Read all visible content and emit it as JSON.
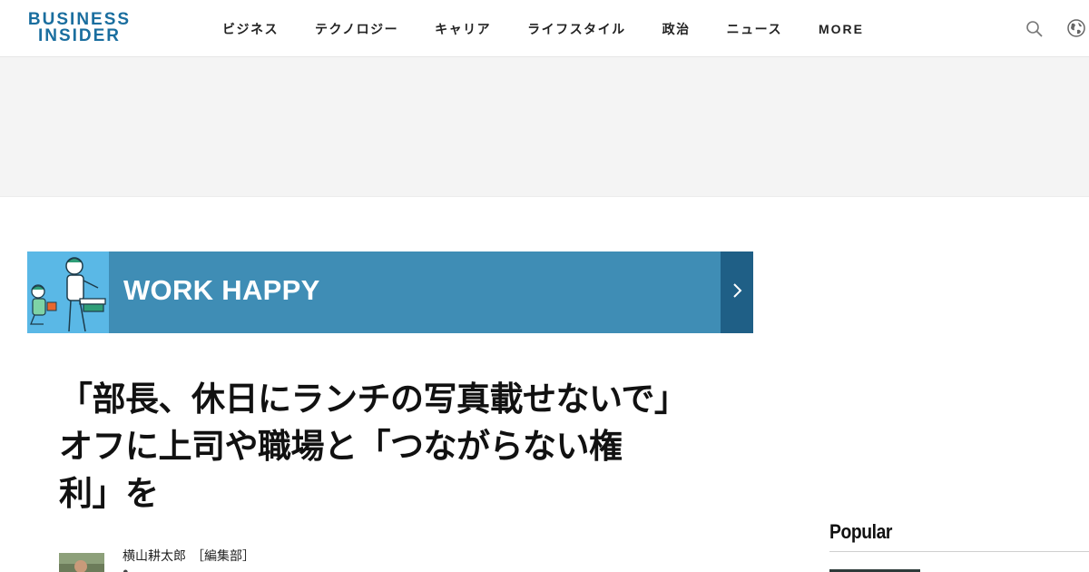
{
  "header": {
    "logo_line1": "BUSINESS",
    "logo_line2": "INSIDER",
    "nav": [
      {
        "label": "ビジネス"
      },
      {
        "label": "テクノロジー"
      },
      {
        "label": "キャリア"
      },
      {
        "label": "ライフスタイル"
      },
      {
        "label": "政治"
      },
      {
        "label": "ニュース"
      },
      {
        "label": "MORE"
      }
    ],
    "icons": {
      "search": "search-icon",
      "globe": "globe-icon"
    },
    "brand_color": "#1a6e9f"
  },
  "banner": {
    "title": "WORK HAPPY",
    "bg_color": "#3f8db5",
    "arrow_color": "#1f5f86",
    "illustration_bg": "#5ab8e6"
  },
  "article": {
    "headline_line1": "「部長、休日にランチの写真載せないで」",
    "headline_line2": "オフに上司や職場と「つながらない権",
    "headline_line3": "利」を",
    "author": "横山耕太郎",
    "dept": "［編集部］"
  },
  "sidebar": {
    "popular_title": "Popular"
  }
}
